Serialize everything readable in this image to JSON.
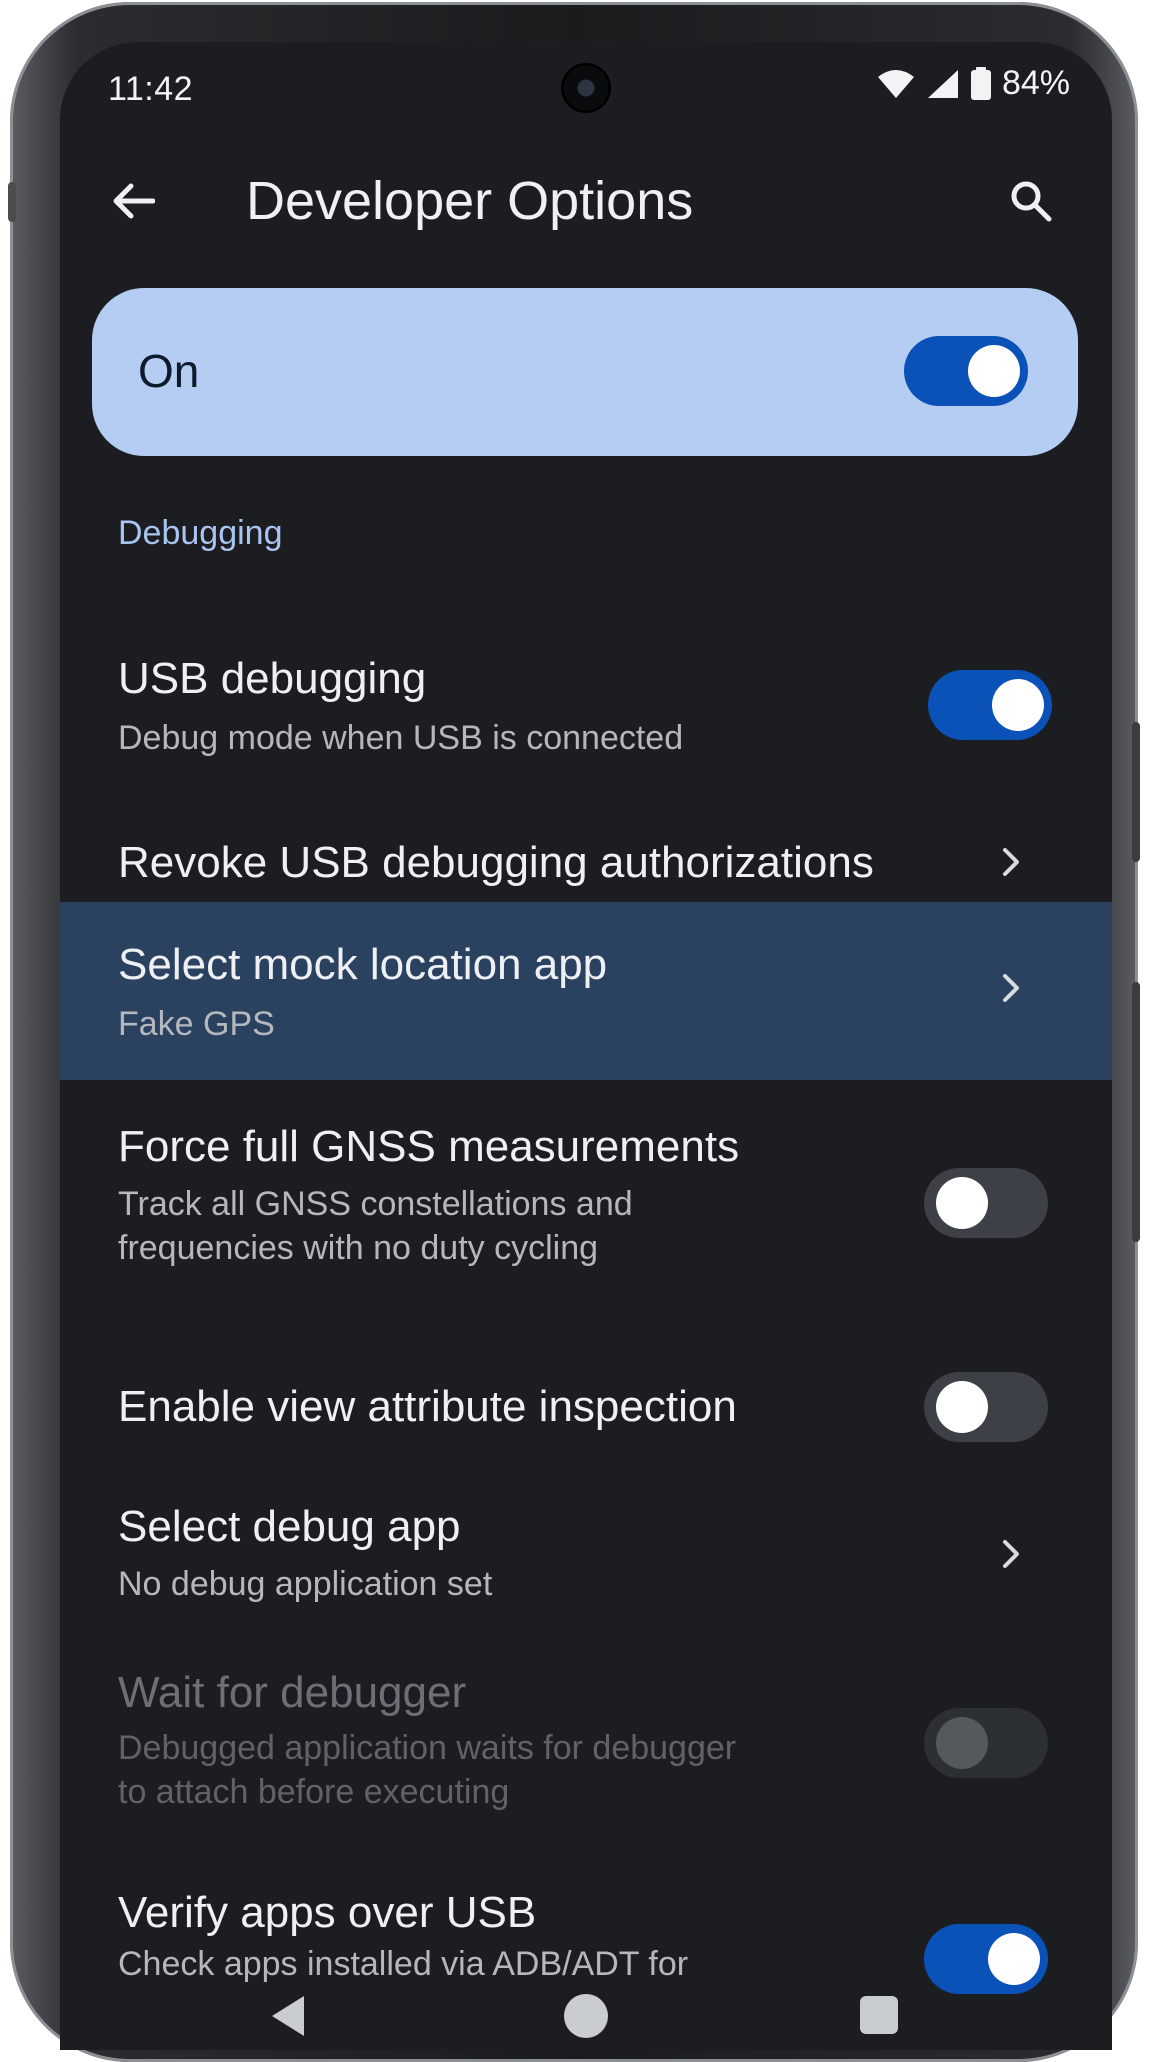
{
  "status_bar": {
    "time": "11:42",
    "battery": "84%",
    "icons": [
      "wifi-icon",
      "signal-icon",
      "battery-icon"
    ]
  },
  "app_bar": {
    "title": "Developer Options",
    "back_icon": "arrow-back-icon",
    "search_icon": "search-icon"
  },
  "master_toggle": {
    "label": "On",
    "checked": true
  },
  "sections": [
    {
      "header": "Debugging",
      "items": [
        {
          "title": "USB debugging",
          "subtitle": "Debug mode when USB is connected",
          "control": "toggle",
          "checked": true
        },
        {
          "title": "Revoke USB debugging authorizations",
          "control": "chevron"
        },
        {
          "title": "Select mock location app",
          "subtitle": "Fake GPS",
          "control": "chevron",
          "highlighted": true
        },
        {
          "title": "Force full GNSS measurements",
          "subtitle_lines": [
            "Track all GNSS constellations and",
            "frequencies with no duty cycling"
          ],
          "control": "toggle",
          "checked": false
        },
        {
          "title": "Enable view attribute inspection",
          "control": "toggle",
          "checked": false
        },
        {
          "title": "Select debug app",
          "subtitle": "No debug application set",
          "control": "chevron"
        },
        {
          "title": "Wait for debugger",
          "subtitle_lines": [
            "Debugged application waits for debugger",
            "to attach before executing"
          ],
          "control": "toggle",
          "checked": false,
          "disabled": true
        },
        {
          "title": "Verify apps over USB",
          "subtitle": "Check apps installed via ADB/ADT for",
          "control": "toggle",
          "checked": true
        }
      ]
    }
  ],
  "colors": {
    "background": "#1b1d21",
    "master_card": "#b6cdf3",
    "accent": "#0b52b8",
    "section_header": "#a9c4ef",
    "highlight_row": "#2b4160"
  },
  "nav_bar": {
    "icons": [
      "nav-back-icon",
      "nav-home-icon",
      "nav-recents-icon"
    ]
  }
}
